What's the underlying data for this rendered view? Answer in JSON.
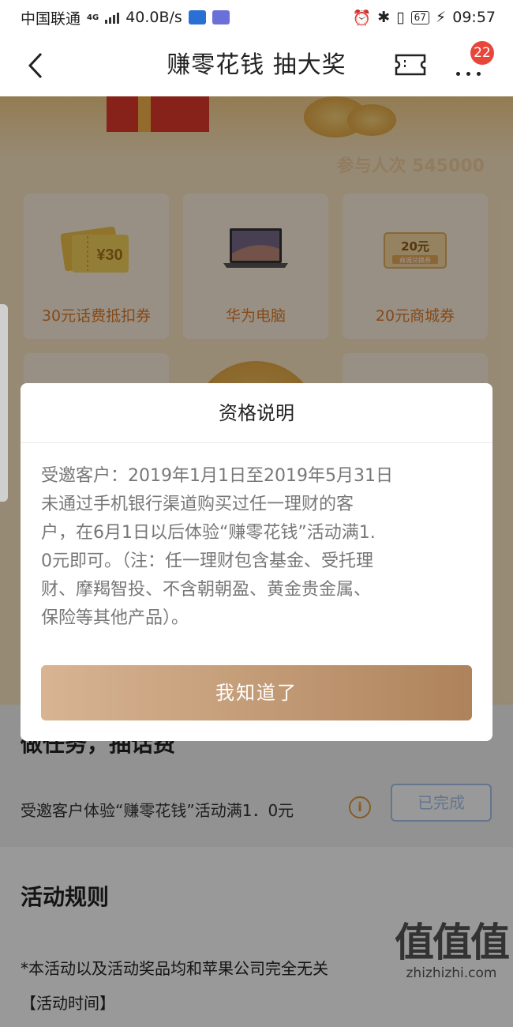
{
  "status_bar": {
    "carrier": "中国联通",
    "network": "4G",
    "speed": "40.0B/s",
    "battery": "67",
    "time": "09:57"
  },
  "nav": {
    "title": "赚零花钱 抽大奖",
    "more_badge": "22"
  },
  "page": {
    "participants": "参与人次 545000",
    "prizes": [
      {
        "name": "30元话费抵扣券",
        "art_text": "¥30",
        "icon": "phone-voucher-icon"
      },
      {
        "name": "华为电脑",
        "icon": "laptop-icon"
      },
      {
        "name": "20元商城券",
        "art_text": "20元",
        "art_sub": "商城兑换券",
        "icon": "mall-voucher-icon"
      }
    ],
    "task": {
      "title": "做任务，抽话费",
      "description": "受邀客户体验“赚零花钱”活动满1．0元",
      "button": "已完成"
    },
    "rules": {
      "title": "活动规则",
      "line1": "*本活动以及活动奖品均和苹果公司完全无关",
      "line2": "【活动时间】"
    },
    "watermark": {
      "big": "值值值",
      "small": "zhizhizhi.com"
    }
  },
  "dialog": {
    "title": "资格说明",
    "lines": [
      "受邀客户：2019年1月1日至2019年5月31日",
      "未通过手机银行渠道购买过任一理财的客",
      "户，在6月1日以后体验“赚零花钱”活动满1.",
      "0元即可。（注：任一理财包含基金、受托理",
      "财、摩羯智投、不含朝朝盈、黄金贵金属、",
      "保险等其他产品）。"
    ],
    "confirm_button": "我知道了"
  },
  "colors": {
    "accent_orange": "#e07b2a",
    "button_gradient_start": "#d8b493",
    "button_gradient_end": "#ae835b",
    "badge_red": "#e8463a"
  }
}
